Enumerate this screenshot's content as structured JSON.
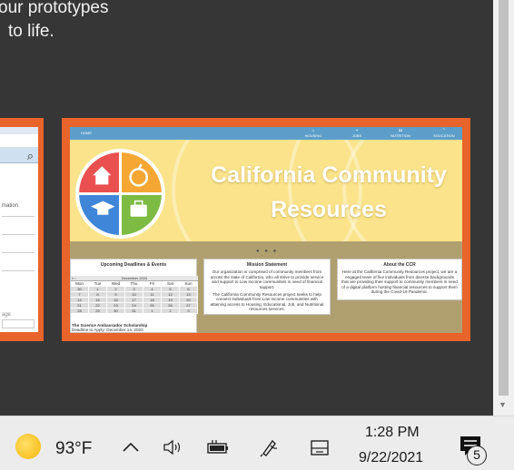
{
  "headline": {
    "line1": "our prototypes",
    "line2": "to life."
  },
  "left_slide": {
    "fragment_text": "mation",
    "fragment_text2": "age"
  },
  "site": {
    "nav": {
      "home": "HOME",
      "items": [
        "HOUSING",
        "JOBS",
        "NUTRITION",
        "EDUCATION"
      ]
    },
    "hero": {
      "title_line1": "California Community",
      "title_line2": "Resources",
      "logo_colors": [
        "#e9504f",
        "#f6a733",
        "#3f86d8",
        "#7dbb42"
      ]
    },
    "carousel_dots": "● ● ●",
    "upcoming": {
      "title": "Upcoming Deadlines & Events",
      "calendar_nav": "« ‹",
      "calendar_month": "December 2020",
      "day_headers": [
        "Mon",
        "Tue",
        "Wed",
        "Thu",
        "Fri",
        "Sat",
        "Sun"
      ],
      "weeks": [
        [
          "30",
          "1",
          "2",
          "3",
          "4",
          "5",
          "6"
        ],
        [
          "7",
          "8",
          "9",
          "10",
          "11",
          "12",
          "13"
        ],
        [
          "14",
          "15",
          "16",
          "17",
          "18",
          "19",
          "20"
        ],
        [
          "21",
          "22",
          "23",
          "24",
          "25",
          "26",
          "27"
        ],
        [
          "28",
          "29",
          "30",
          "31",
          "1",
          "2",
          "3"
        ]
      ],
      "event_title": "The Science Ambassador Scholarship",
      "event_deadline": "Deadline to Apply: December 14, 2020"
    },
    "mission": {
      "title": "Mission Statement",
      "p1": "Our organization is comprised of community members from across the state of California, who all strive to provide service and support to Low income communities in need of financial support.",
      "p2": "The California Community Resources project seeks to help connect individuals from Low Income communities with attaining access to Housing, Educational, Job, and Nutritional resources services."
    },
    "about": {
      "title": "About the CCR",
      "body": "Here at the California Community Resources project, we are a engaged team of five individuals from diverse backgrounds that are providing their support to community members in need of a digital platform hosting financial resources to support them during the Covid-19 Pandemic."
    }
  },
  "taskbar": {
    "temperature": "93°F",
    "time": "1:28 PM",
    "date": "9/22/2021",
    "notification_count": "5"
  }
}
